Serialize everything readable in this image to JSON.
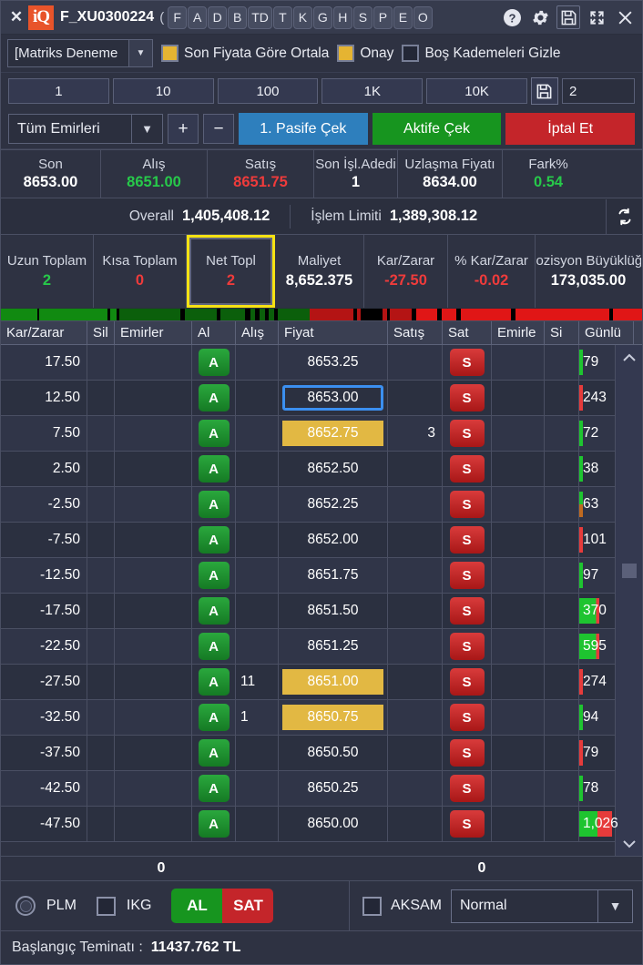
{
  "titlebar": {
    "close_left": "✕",
    "logo": "iQ",
    "symbol": "F_XU0300224",
    "paren": "(",
    "mini_buttons": [
      "F",
      "A",
      "D",
      "B",
      "TD",
      "T",
      "K",
      "G",
      "H",
      "S",
      "P",
      "E",
      "O"
    ],
    "icons": {
      "help": "?",
      "settings": "gear",
      "save": "save",
      "restore": "restore",
      "close": "✕"
    }
  },
  "options": {
    "account": "[Matriks Deneme",
    "checkbox1_label": "Son Fiyata Göre Ortala",
    "checkbox1_on": true,
    "checkbox2_label": "Onay",
    "checkbox2_on": true,
    "checkbox3_label": "Boş Kademeleri Gizle",
    "checkbox3_on": false
  },
  "quantity": {
    "presets": [
      "1",
      "10",
      "100",
      "1K",
      "10K"
    ],
    "value": "2",
    "placeholder": "2"
  },
  "actions": {
    "order_filter": "Tüm Emirleri",
    "plus": "+",
    "minus": "−",
    "passive": "1. Pasife Çek",
    "active": "Aktife Çek",
    "cancel": "İptal Et"
  },
  "quotes": [
    {
      "label": "Son",
      "value": "8653.00",
      "color": "white"
    },
    {
      "label": "Alış",
      "value": "8651.00",
      "color": "green"
    },
    {
      "label": "Satış",
      "value": "8651.75",
      "color": "red"
    },
    {
      "label": "Son İşl.Adedi",
      "value": "1",
      "color": "white"
    },
    {
      "label": "Uzlaşma Fiyatı",
      "value": "8634.00",
      "color": "white"
    },
    {
      "label": "Fark%",
      "value": "0.54",
      "color": "green"
    }
  ],
  "overall": {
    "label1": "Overall",
    "value1": "1,405,408.12",
    "label2": "İşlem Limiti",
    "value2": "1,389,308.12"
  },
  "position": [
    {
      "label": "Uzun Toplam",
      "value": "2",
      "color": "green",
      "selected": false
    },
    {
      "label": "Kısa Toplam",
      "value": "0",
      "color": "red",
      "selected": false
    },
    {
      "label": "Net Topl",
      "value": "2",
      "color": "red",
      "selected": true
    },
    {
      "label": "Maliyet",
      "value": "8,652.375",
      "color": "white",
      "selected": false
    },
    {
      "label": "Kar/Zarar",
      "value": "-27.50",
      "color": "red",
      "selected": false
    },
    {
      "label": "% Kar/Zarar",
      "value": "-0.02",
      "color": "red",
      "selected": false
    },
    {
      "label": "Pozisyon Büyüklüğü",
      "value": "173,035.00",
      "color": "white",
      "selected": false
    }
  ],
  "depth_bar": {
    "green_pct": 43,
    "red_pct": 57
  },
  "table": {
    "columns": [
      "Kar/Zarar",
      "Sil",
      "Emirler",
      "Al",
      "Alış",
      "Fiyat",
      "Satış",
      "Sat",
      "Emirle",
      "Si",
      "Günlü"
    ],
    "rows": [
      {
        "pnl": "17.50",
        "sil": "",
        "emirler": "",
        "al": "A",
        "alis": "",
        "fiyat": "8653.25",
        "fiyat_state": "none",
        "satis": "",
        "sat": "S",
        "emirler2": "",
        "si": "",
        "gunluk": "79",
        "bar": "green"
      },
      {
        "pnl": "12.50",
        "sil": "",
        "emirler": "",
        "al": "A",
        "alis": "",
        "fiyat": "8653.00",
        "fiyat_state": "selected",
        "satis": "",
        "sat": "S",
        "emirler2": "",
        "si": "",
        "gunluk": "243",
        "bar": "red"
      },
      {
        "pnl": "7.50",
        "sil": "",
        "emirler": "",
        "al": "A",
        "alis": "",
        "fiyat": "8652.75",
        "fiyat_state": "highlight",
        "satis": "3",
        "sat": "S",
        "emirler2": "",
        "si": "",
        "gunluk": "72",
        "bar": "green"
      },
      {
        "pnl": "2.50",
        "sil": "",
        "emirler": "",
        "al": "A",
        "alis": "",
        "fiyat": "8652.50",
        "fiyat_state": "none",
        "satis": "",
        "sat": "S",
        "emirler2": "",
        "si": "",
        "gunluk": "38",
        "bar": "green"
      },
      {
        "pnl": "-2.50",
        "sil": "",
        "emirler": "",
        "al": "A",
        "alis": "",
        "fiyat": "8652.25",
        "fiyat_state": "none",
        "satis": "",
        "sat": "S",
        "emirler2": "",
        "si": "",
        "gunluk": "63",
        "bar": "mixed"
      },
      {
        "pnl": "-7.50",
        "sil": "",
        "emirler": "",
        "al": "A",
        "alis": "",
        "fiyat": "8652.00",
        "fiyat_state": "none",
        "satis": "",
        "sat": "S",
        "emirler2": "",
        "si": "",
        "gunluk": "101",
        "bar": "red"
      },
      {
        "pnl": "-12.50",
        "sil": "",
        "emirler": "",
        "al": "A",
        "alis": "",
        "fiyat": "8651.75",
        "fiyat_state": "none",
        "satis": "",
        "sat": "S",
        "emirler2": "",
        "si": "",
        "gunluk": "97",
        "bar": "green"
      },
      {
        "pnl": "-17.50",
        "sil": "",
        "emirler": "",
        "al": "A",
        "alis": "",
        "fiyat": "8651.50",
        "fiyat_state": "none",
        "satis": "",
        "sat": "S",
        "emirler2": "",
        "si": "",
        "gunluk": "370",
        "bar": "greenwide"
      },
      {
        "pnl": "-22.50",
        "sil": "",
        "emirler": "",
        "al": "A",
        "alis": "",
        "fiyat": "8651.25",
        "fiyat_state": "none",
        "satis": "",
        "sat": "S",
        "emirler2": "",
        "si": "",
        "gunluk": "595",
        "bar": "greenwide"
      },
      {
        "pnl": "-27.50",
        "sil": "",
        "emirler": "",
        "al": "A",
        "alis": "11",
        "fiyat": "8651.00",
        "fiyat_state": "highlight",
        "satis": "",
        "sat": "S",
        "emirler2": "",
        "si": "",
        "gunluk": "274",
        "bar": "red"
      },
      {
        "pnl": "-32.50",
        "sil": "",
        "emirler": "",
        "al": "A",
        "alis": "1",
        "fiyat": "8650.75",
        "fiyat_state": "highlight",
        "satis": "",
        "sat": "S",
        "emirler2": "",
        "si": "",
        "gunluk": "94",
        "bar": "green"
      },
      {
        "pnl": "-37.50",
        "sil": "",
        "emirler": "",
        "al": "A",
        "alis": "",
        "fiyat": "8650.50",
        "fiyat_state": "none",
        "satis": "",
        "sat": "S",
        "emirler2": "",
        "si": "",
        "gunluk": "79",
        "bar": "red"
      },
      {
        "pnl": "-42.50",
        "sil": "",
        "emirler": "",
        "al": "A",
        "alis": "",
        "fiyat": "8650.25",
        "fiyat_state": "none",
        "satis": "",
        "sat": "S",
        "emirler2": "",
        "si": "",
        "gunluk": "78",
        "bar": "green"
      },
      {
        "pnl": "-47.50",
        "sil": "",
        "emirler": "",
        "al": "A",
        "alis": "",
        "fiyat": "8650.00",
        "fiyat_state": "none",
        "satis": "",
        "sat": "S",
        "emirler2": "",
        "si": "",
        "gunluk": "1,026",
        "bar": "greenred"
      }
    ]
  },
  "totals": {
    "buy": "0",
    "sell": "0"
  },
  "bottom": {
    "radio_label": "PLM",
    "checkbox_ikg": "IKG",
    "buy_button": "AL",
    "sell_button": "SAT",
    "checkbox_aksam": "AKSAM",
    "mode": "Normal"
  },
  "footer": {
    "label": "Başlangıç Teminatı :",
    "value": "11437.762 TL"
  }
}
